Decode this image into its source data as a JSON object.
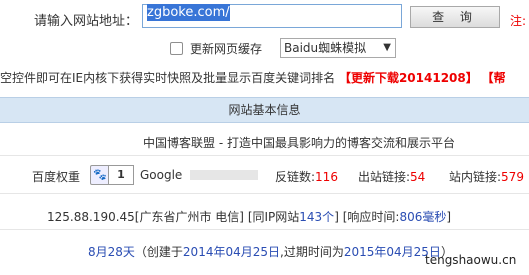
{
  "form": {
    "url_label": "请输入网站地址：",
    "url_value": "zgboke.com/",
    "query_button": "查 询",
    "note": "注:",
    "refresh_label": "更新网页缓存",
    "select_value": "Baidu蜘蛛模拟",
    "select_caret": "▼"
  },
  "plugin": {
    "text": "空控件即可在IE内核下获得实时快照及批量显示百度关键词排名",
    "download": "【更新下载20141208】",
    "help": "【帮"
  },
  "section": {
    "title": "网站基本信息"
  },
  "site": {
    "title": "中国博客联盟 - 打造中国最具影响力的博客交流和展示平台"
  },
  "metrics": {
    "pr_label": "百度权重",
    "paw_icon": "🐾",
    "pr_value": "1",
    "google_label": "Google",
    "backlinks_label": "反链数:",
    "backlinks_value": "116",
    "outlinks_label": "出站链接:",
    "outlinks_value": "54",
    "inlinks_label": "站内链接:",
    "inlinks_value": "579"
  },
  "ip": {
    "ip": "125.88.190.45",
    "location": "[广东省广州市 电信]",
    "same_ip_prefix": "[同IP网站",
    "same_ip_count": "143个",
    "same_ip_suffix": "]",
    "resp_prefix": "[响应时间:",
    "resp_value": "806毫秒",
    "resp_suffix": "]"
  },
  "domain_age": {
    "age": "8月28天",
    "text1": "（创建于",
    "created": "2014年04月25日",
    "text2": ",过期时间为",
    "expires": "2015年04月25日",
    "text3": "）"
  },
  "watermark": "tengshaowu.cn"
}
